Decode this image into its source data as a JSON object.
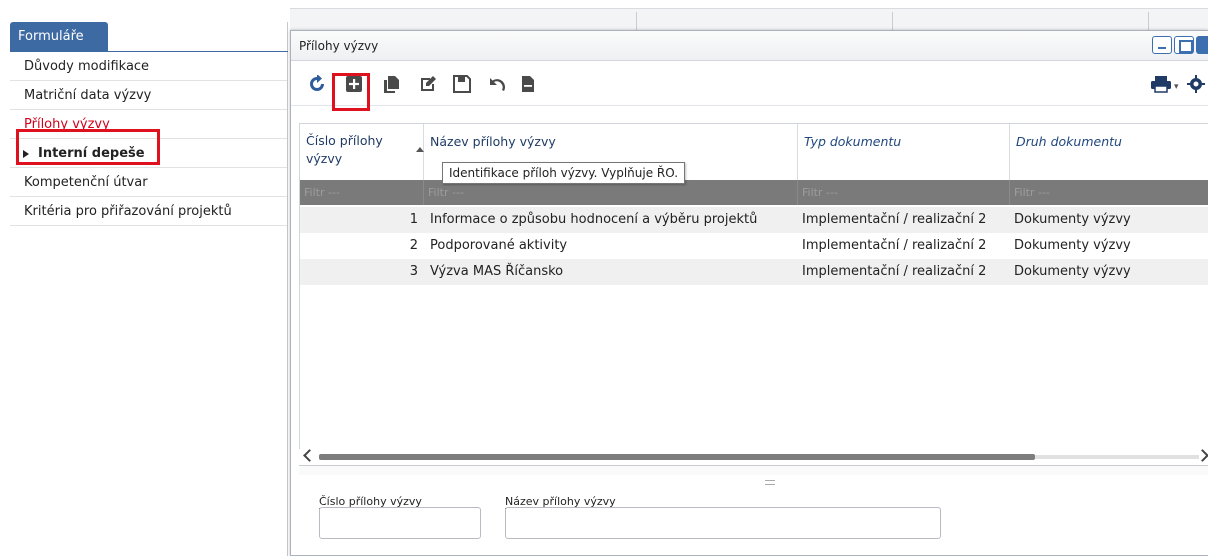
{
  "sidebar": {
    "header": "Formuláře",
    "items": [
      {
        "label": "Důvody modifikace"
      },
      {
        "label": "Matriční data výzvy"
      },
      {
        "label": "Přílohy výzvy"
      },
      {
        "label": "Interní depeše"
      },
      {
        "label": "Kompetenční útvar"
      },
      {
        "label": "Kritéria pro přiřazování projektů"
      }
    ]
  },
  "dialog": {
    "title": "Přílohy výzvy"
  },
  "toolbar": {
    "icons": [
      "refresh-icon",
      "add-icon",
      "copy-icon",
      "edit-icon",
      "save-icon",
      "undo-icon",
      "document-icon",
      "print-icon",
      "settings-icon"
    ]
  },
  "grid": {
    "columns": [
      {
        "label": "Číslo přílohy výzvy"
      },
      {
        "label": "Název přílohy výzvy"
      },
      {
        "label": "Typ dokumentu"
      },
      {
        "label": "Druh dokumentu"
      }
    ],
    "filter_placeholder": "Filtr ---",
    "rows": [
      {
        "num": "1",
        "name": "Informace o způsobu hodnocení a výběru projektů",
        "type": "Implementační / realizační 2",
        "kind": "Dokumenty výzvy"
      },
      {
        "num": "2",
        "name": "Podporované aktivity",
        "type": "Implementační / realizační 2",
        "kind": "Dokumenty výzvy"
      },
      {
        "num": "3",
        "name": "Výzva MAS Říčansko",
        "type": "Implementační / realizační 2",
        "kind": "Dokumenty výzvy"
      }
    ],
    "tooltip": "Identifikace příloh výzvy. Vyplňuje ŘO."
  },
  "form": {
    "field1_label": "Číslo přílohy výzvy",
    "field2_label": "Název přílohy výzvy"
  },
  "colors": {
    "accent": "#3d6aa2",
    "highlight": "#e0111e",
    "filter_bg": "#7a7a7a"
  }
}
